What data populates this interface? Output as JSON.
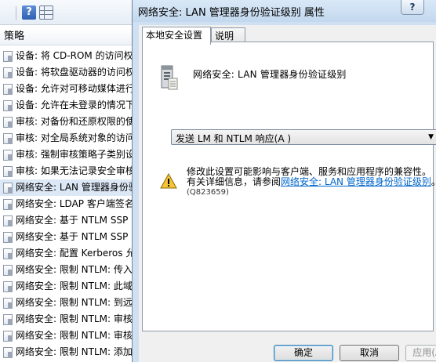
{
  "background_window": {
    "column_header": "策略",
    "policies": [
      "设备: 将 CD-ROM 的访问权",
      "设备: 将软盘驱动器的访问权",
      "设备: 允许对可移动媒体进行",
      "设备: 允许在未登录的情况下",
      "审核: 对备份和还原权限的使",
      "审核: 对全局系统对象的访问",
      "审核: 强制审核策略子类别设",
      "审核: 如果无法记录安全审核",
      "网络安全: LAN 管理器身份验",
      "网络安全: LDAP 客户端签名",
      "网络安全: 基于 NTLM SSP",
      "网络安全: 基于 NTLM SSP",
      "网络安全: 配置 Kerberos 允",
      "网络安全: 限制 NTLM: 传入",
      "网络安全: 限制 NTLM: 此域",
      "网络安全: 限制 NTLM: 到远",
      "网络安全: 限制 NTLM: 审核",
      "网络安全: 限制 NTLM: 审核",
      "网络安全: 限制 NTLM: 添加"
    ],
    "selected_index": 8
  },
  "dialog": {
    "title": "网络安全: LAN 管理器身份验证级别 属性",
    "help_button": "?",
    "tabs": [
      "本地安全设置",
      "说明"
    ],
    "policy_name": "网络安全: LAN 管理器身份验证级别",
    "dropdown_value": "发送 LM 和 NTLM 响应(A )",
    "warning_line1": "修改此设置可能影响与客户端、服务和应用程序的兼容性。",
    "warning_line2_prefix": "有关详细信息，请参阅",
    "warning_link": "网络安全: LAN 管理器身份验证级别",
    "warning_line2_suffix": "。",
    "warning_kb": "(Q823659)",
    "buttons": {
      "ok": "确定",
      "cancel": "取消",
      "apply": "应用(A)"
    }
  }
}
